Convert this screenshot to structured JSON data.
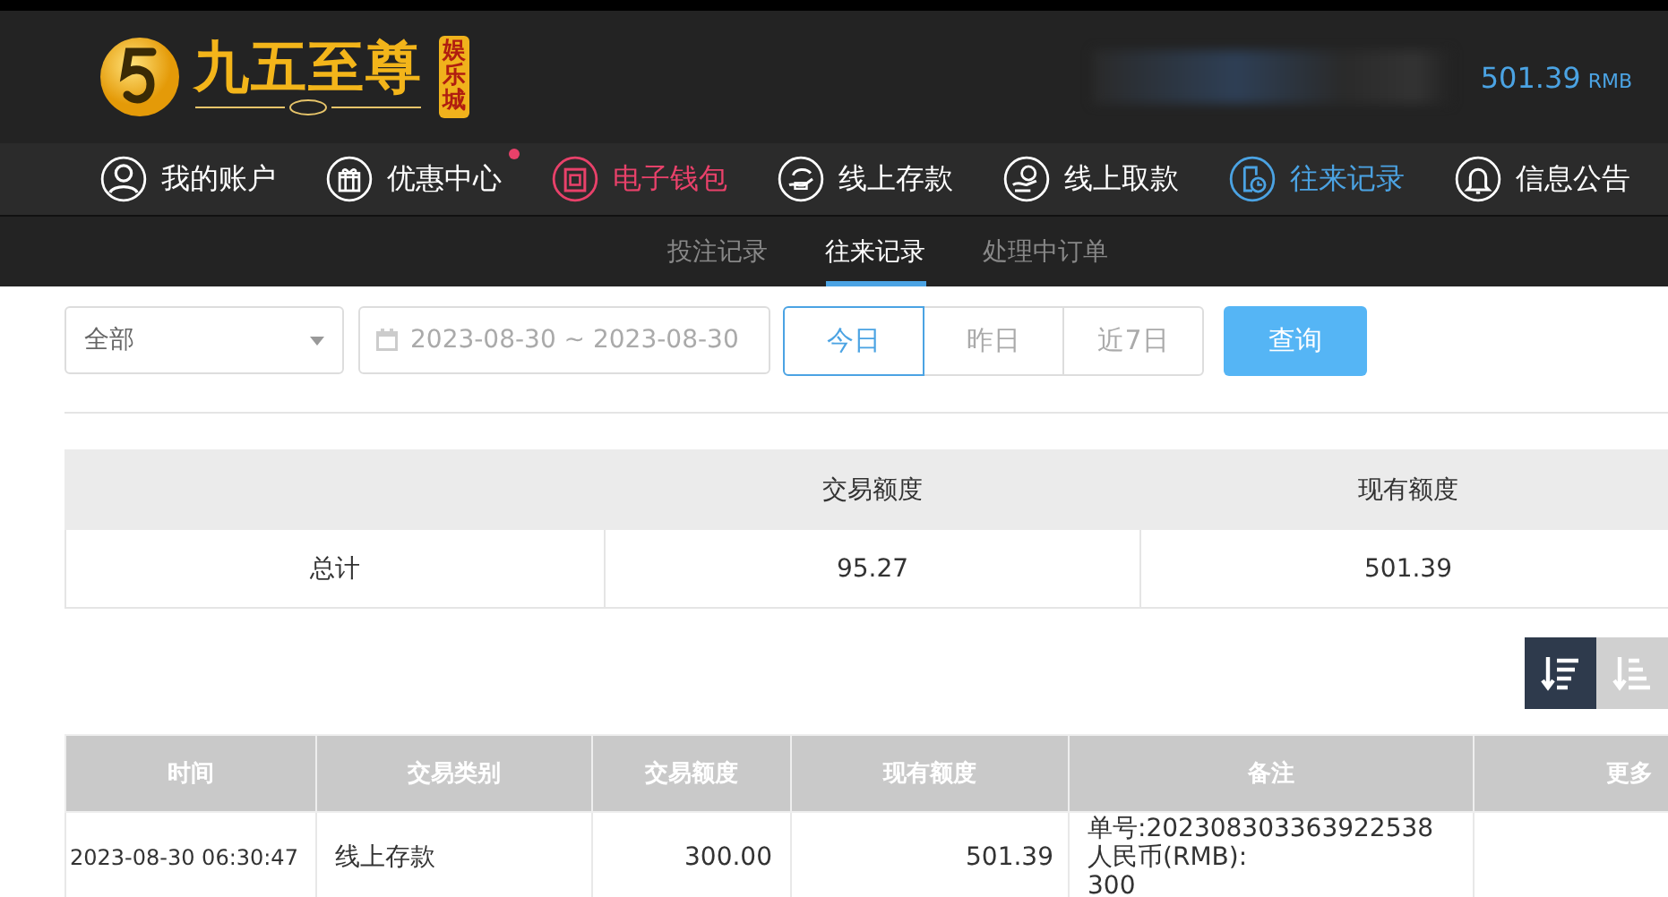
{
  "header": {
    "logo_title": "九五至尊",
    "logo_badge": "娱乐城",
    "balance": "501.39",
    "currency": "RMB"
  },
  "nav": [
    {
      "label": "我的账户",
      "kind": "user",
      "selected": false,
      "hot": false,
      "badge": false
    },
    {
      "label": "优惠中心",
      "kind": "gift",
      "selected": false,
      "hot": false,
      "badge": true
    },
    {
      "label": "电子钱包",
      "kind": "wallet",
      "selected": false,
      "hot": true,
      "badge": false
    },
    {
      "label": "线上存款",
      "kind": "deposit",
      "selected": false,
      "hot": false,
      "badge": false
    },
    {
      "label": "线上取款",
      "kind": "withdraw",
      "selected": false,
      "hot": false,
      "badge": false
    },
    {
      "label": "往来记录",
      "kind": "record",
      "selected": true,
      "hot": false,
      "badge": false
    },
    {
      "label": "信息公告",
      "kind": "bell",
      "selected": false,
      "hot": false,
      "badge": false
    }
  ],
  "subtabs": [
    {
      "label": "投注记录",
      "selected": false
    },
    {
      "label": "往来记录",
      "selected": true
    },
    {
      "label": "处理中订单",
      "selected": false
    }
  ],
  "filter": {
    "type_select": "全部",
    "date_range": "2023-08-30 ~ 2023-08-30",
    "quick": [
      {
        "label": "今日",
        "selected": true
      },
      {
        "label": "昨日",
        "selected": false
      },
      {
        "label": "近7日",
        "selected": false
      }
    ],
    "query_button": "查询"
  },
  "summary": {
    "columns": [
      "交易额度",
      "现有额度"
    ],
    "row": {
      "label": "总计",
      "cells": [
        "95.27",
        "501.39"
      ]
    }
  },
  "sort_buttons": [
    {
      "selected": true
    },
    {
      "selected": false
    }
  ],
  "records": {
    "columns": [
      "时间",
      "交易类别",
      "交易额度",
      "现有额度",
      "备注",
      "更多"
    ],
    "rows": [
      {
        "time": "2023-08-30 06:30:47",
        "type": "线上存款",
        "amount": "300.00",
        "balance": "501.39",
        "note": [
          "单号:202308303363922538",
          "人民币(RMB):",
          "300"
        ]
      }
    ]
  }
}
